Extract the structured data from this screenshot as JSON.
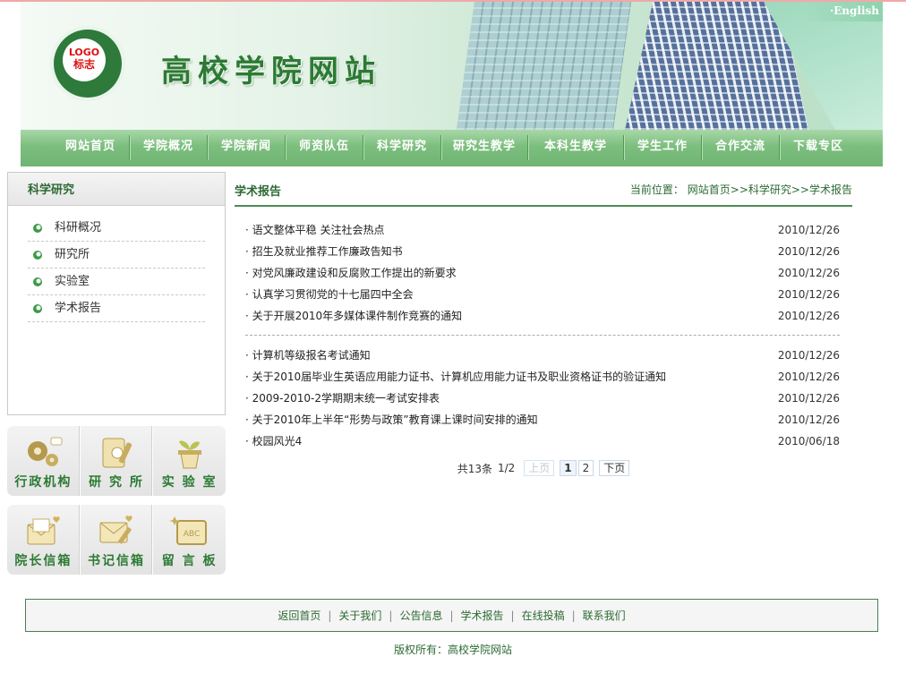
{
  "header": {
    "logo_line1": "LOGO",
    "logo_line2": "标志",
    "site_title": "高校学院网站",
    "english_link": "·English"
  },
  "nav": [
    "网站首页",
    "学院概况",
    "学院新闻",
    "师资队伍",
    "科学研究",
    "研究生教学",
    "本科生教学",
    "学生工作",
    "合作交流",
    "下载专区"
  ],
  "sidebar": {
    "title": "科学研究",
    "items": [
      "科研概况",
      "研究所",
      "实验室",
      "学术报告"
    ]
  },
  "quick_links": {
    "row1": [
      {
        "label": "行政机构",
        "icon": "gears-icon"
      },
      {
        "label": "研 究 所",
        "icon": "notebook-pen-icon"
      },
      {
        "label": "实 验 室",
        "icon": "plant-pot-icon"
      }
    ],
    "row2": [
      {
        "label": "院长信箱",
        "icon": "envelope-heart-icon"
      },
      {
        "label": "书记信箱",
        "icon": "envelope-pen-icon"
      },
      {
        "label": "留 言 板",
        "icon": "chalkboard-icon"
      }
    ]
  },
  "main": {
    "title": "学术报告",
    "breadcrumb_prefix": "当前位置：",
    "breadcrumb": "网站首页>>科学研究>>学术报告",
    "articles_group1": [
      {
        "title": "语文整体平稳 关注社会热点",
        "date": "2010/12/26"
      },
      {
        "title": "招生及就业推荐工作廉政告知书",
        "date": "2010/12/26"
      },
      {
        "title": "对党风廉政建设和反腐败工作提出的新要求",
        "date": "2010/12/26"
      },
      {
        "title": "认真学习贯彻党的十七届四中全会",
        "date": "2010/12/26"
      },
      {
        "title": "关于开展2010年多媒体课件制作竞赛的通知",
        "date": "2010/12/26"
      }
    ],
    "articles_group2": [
      {
        "title": "计算机等级报名考试通知",
        "date": "2010/12/26"
      },
      {
        "title": "关于2010届毕业生英语应用能力证书、计算机应用能力证书及职业资格证书的验证通知",
        "date": "2010/12/26"
      },
      {
        "title": "2009-2010-2学期期末统一考试安排表",
        "date": "2010/12/26"
      },
      {
        "title": "关于2010年上半年“形势与政策”教育课上课时间安排的通知",
        "date": "2010/12/26"
      },
      {
        "title": "校园风光4",
        "date": "2010/06/18"
      }
    ],
    "pager": {
      "total": "共13条",
      "page": "1/2",
      "prev": "上页",
      "pages": [
        "1",
        "2"
      ],
      "next": "下页"
    }
  },
  "footer": {
    "links": [
      "返回首页",
      "关于我们",
      "公告信息",
      "学术报告",
      "在线投稿",
      "联系我们"
    ],
    "copyright": "版权所有：高校学院网站"
  },
  "colors": {
    "brand_green": "#2c7a33",
    "nav_green": "#7cbe7e"
  }
}
